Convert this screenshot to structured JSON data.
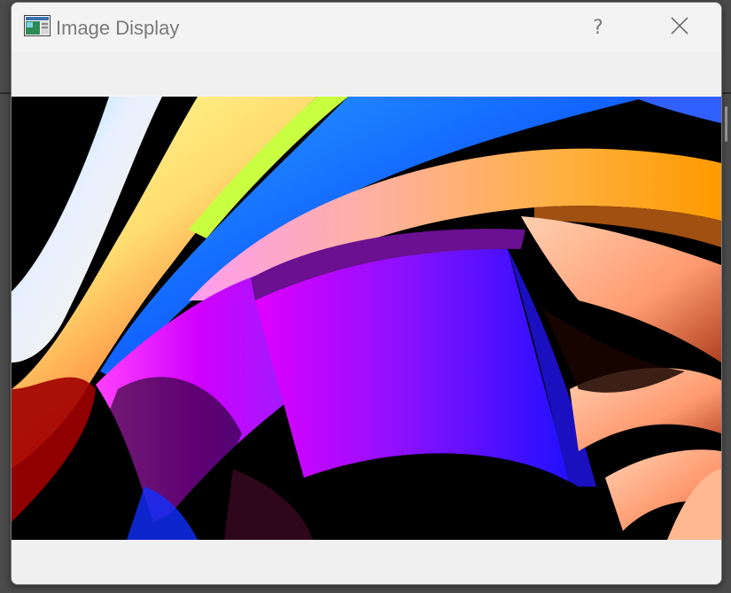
{
  "window": {
    "title": "Image Display",
    "help_label": "?",
    "icons": {
      "app": "app-window-icon",
      "close": "close-icon"
    }
  },
  "image": {
    "description_name": "abstract-ribbon-image"
  }
}
